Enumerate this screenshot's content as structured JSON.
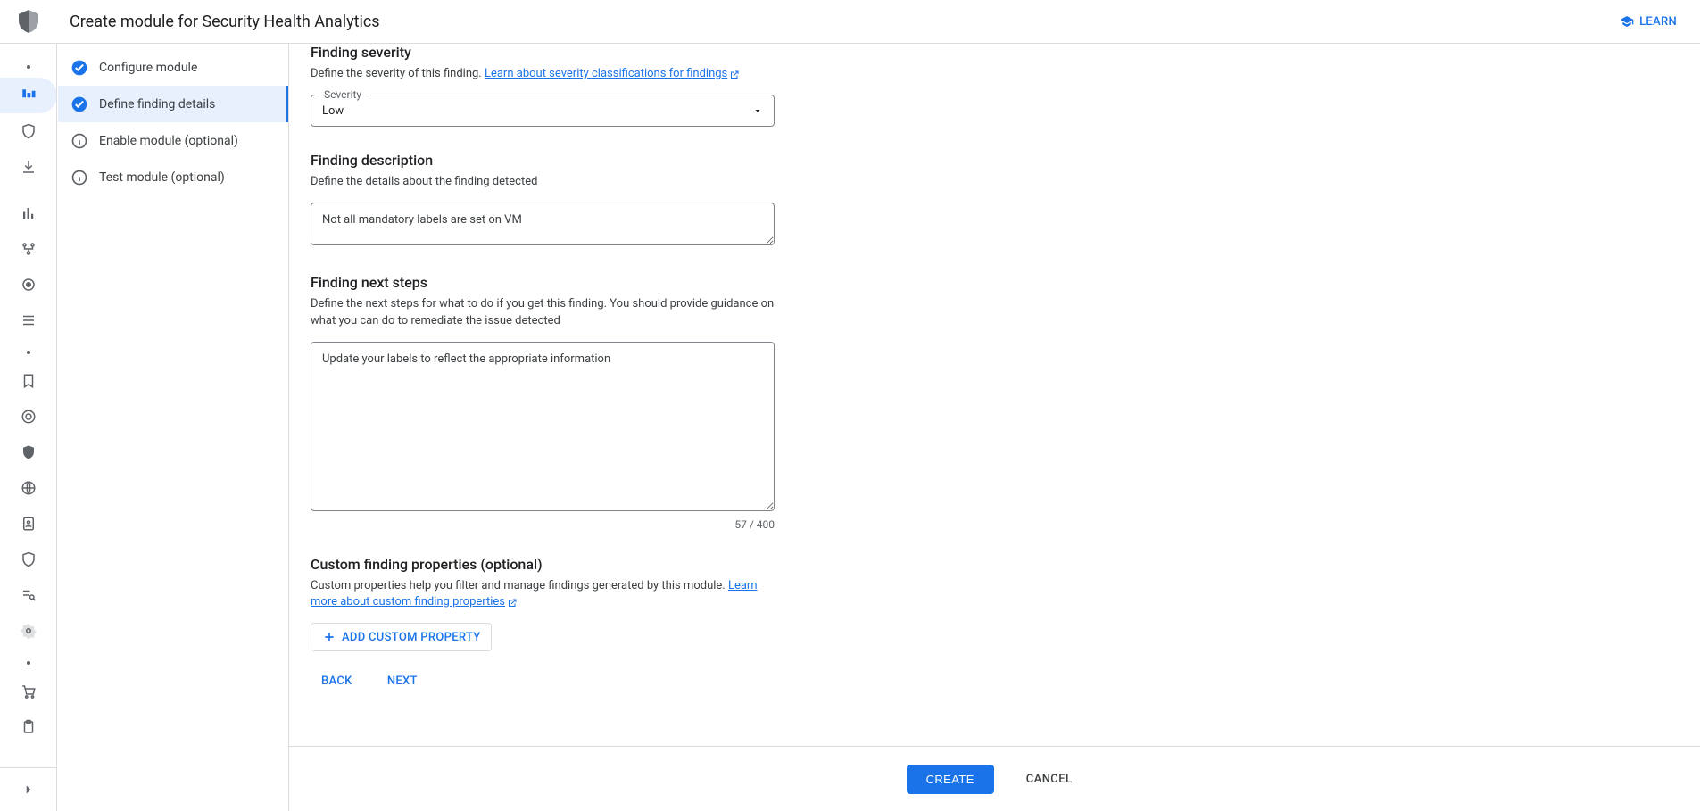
{
  "header": {
    "title": "Create module for Security Health Analytics",
    "learn_label": "LEARN"
  },
  "rail": {
    "items": [
      {
        "name": "overview-icon",
        "type": "dot"
      },
      {
        "name": "dashboard-icon",
        "active": true
      },
      {
        "name": "shield-outline-icon"
      },
      {
        "name": "download-icon"
      },
      {
        "name": "bar-chart-icon"
      },
      {
        "name": "tree-icon"
      },
      {
        "name": "eye-scan-icon"
      },
      {
        "name": "list-icon"
      },
      {
        "name": "more-dot",
        "type": "dot"
      },
      {
        "name": "bookmark-icon"
      },
      {
        "name": "target-icon"
      },
      {
        "name": "shield-solid-icon"
      },
      {
        "name": "globe-icon"
      },
      {
        "name": "id-badge-icon"
      },
      {
        "name": "shield-outline2-icon"
      },
      {
        "name": "search-list-icon"
      },
      {
        "name": "settings-icon"
      },
      {
        "name": "more-dot2",
        "type": "dot"
      },
      {
        "name": "cart-icon"
      },
      {
        "name": "clipboard-icon"
      }
    ]
  },
  "stepper": {
    "items": [
      {
        "label": "Configure module",
        "state": "done"
      },
      {
        "label": "Define finding details",
        "state": "done",
        "active": true
      },
      {
        "label": "Enable module (optional)",
        "state": "info"
      },
      {
        "label": "Test module (optional)",
        "state": "info"
      }
    ]
  },
  "form": {
    "severity": {
      "title": "Finding severity",
      "desc_prefix": "Define the severity of this finding. ",
      "link_text": "Learn about severity classifications for findings",
      "label": "Severity",
      "value": "Low"
    },
    "description": {
      "title": "Finding description",
      "desc": "Define the details about the finding detected",
      "value": "Not all mandatory labels are set on VM"
    },
    "next_steps": {
      "title": "Finding next steps",
      "desc": "Define the next steps for what to do if you get this finding. You should provide guidance on what you can do to remediate the issue detected",
      "value": "Update your labels to reflect the appropriate information",
      "counter": "57 / 400"
    },
    "custom_props": {
      "title": "Custom finding properties (optional)",
      "desc_prefix": "Custom properties help you filter and manage findings generated by this module. ",
      "link_text": "Learn more about custom finding properties",
      "add_label": "ADD CUSTOM PROPERTY"
    },
    "nav": {
      "back": "BACK",
      "next": "NEXT"
    }
  },
  "footer": {
    "create": "CREATE",
    "cancel": "CANCEL"
  }
}
